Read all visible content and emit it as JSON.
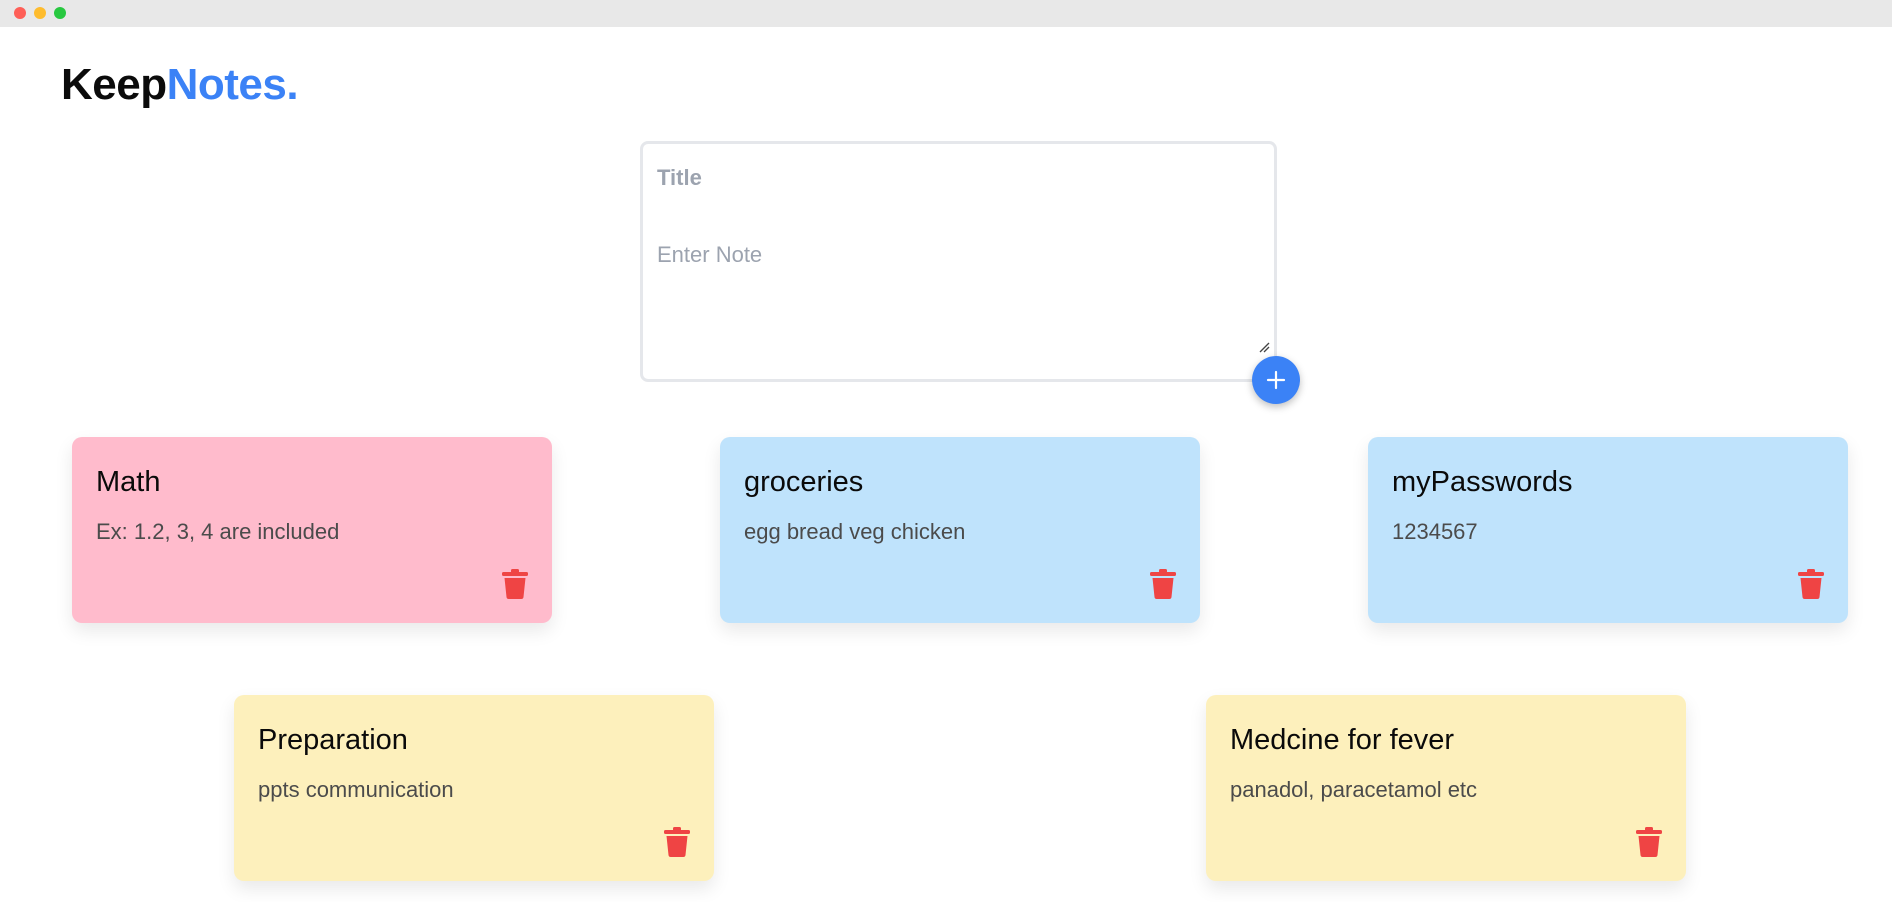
{
  "colors": {
    "brand": "#3b82f6",
    "pink": "#ffbbcc",
    "blue": "#bfe3fc",
    "yellow": "#fdf0bc",
    "trash": "#ef4444"
  },
  "logo": {
    "part1": "Keep",
    "part2": "Notes."
  },
  "composer": {
    "title_placeholder": "Title",
    "note_placeholder": "Enter Note",
    "add_icon": "plus-icon"
  },
  "notes": [
    {
      "title": "Math",
      "body": "Ex: 1.2, 3, 4 are included",
      "color": "pink",
      "delete_icon": "trash-icon"
    },
    {
      "title": "groceries",
      "body": "egg bread veg chicken",
      "color": "blue",
      "delete_icon": "trash-icon"
    },
    {
      "title": "myPasswords",
      "body": "1234567",
      "color": "blue",
      "delete_icon": "trash-icon"
    },
    {
      "title": "Preparation",
      "body": "ppts communication",
      "color": "yellow",
      "delete_icon": "trash-icon"
    },
    {
      "title": "Medcine for fever",
      "body": "panadol, paracetamol etc",
      "color": "yellow",
      "delete_icon": "trash-icon"
    }
  ]
}
